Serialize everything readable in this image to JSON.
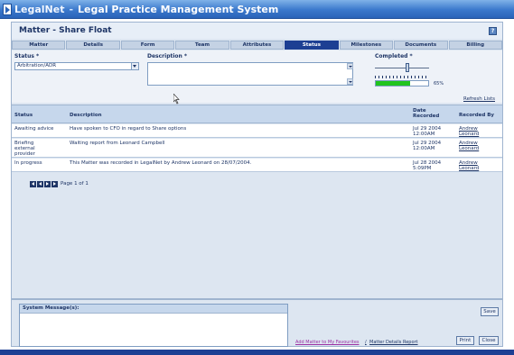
{
  "app": {
    "brand": "LegalNet",
    "separator": "-",
    "title": "Legal Practice Management System"
  },
  "page": {
    "title": "Matter - Share Float",
    "help_icon_label": "?"
  },
  "tabs": [
    {
      "label": "Matter"
    },
    {
      "label": "Details"
    },
    {
      "label": "Form"
    },
    {
      "label": "Team"
    },
    {
      "label": "Attributes"
    },
    {
      "label": "Status",
      "active": true
    },
    {
      "label": "Milestones"
    },
    {
      "label": "Documents"
    },
    {
      "label": "Billing"
    }
  ],
  "form": {
    "status_label": "Status *",
    "status_value": "Arbitration/ADR",
    "description_label": "Description *",
    "description_value": "",
    "completed_label": "Completed *",
    "completed_percent_text": "65%",
    "completed_fraction": 0.65
  },
  "refresh_lists": "Refresh Lists",
  "table": {
    "headers": {
      "status": "Status",
      "description": "Description",
      "date": "Date Recorded",
      "recorded_by": "Recorded By"
    },
    "rows": [
      {
        "status": "Awaiting advice",
        "description": "Have spoken to CFO in regard to Share options",
        "date_line1": "Jul 29 2004",
        "date_line2": "12:00AM",
        "by_line1": "Andrew",
        "by_line2": "Leonard"
      },
      {
        "status": "Briefing external provider",
        "description": "Waiting report from Leonard Campbell",
        "date_line1": "Jul 29 2004",
        "date_line2": "12:00AM",
        "by_line1": "Andrew",
        "by_line2": "Leonard"
      },
      {
        "status": "In progress",
        "description": "This Matter was recorded in LegalNet by Andrew Leonard on 28/07/2004.",
        "date_line1": "Jul 28 2004",
        "date_line2": "5:09PM",
        "by_line1": "Andrew",
        "by_line2": "Leonard"
      }
    ]
  },
  "pager": {
    "text": "Page 1 of 1"
  },
  "system_message": {
    "label": "System Message(s):"
  },
  "buttons": {
    "save": "Save",
    "print": "Print",
    "close": "Close"
  },
  "links": {
    "add_favourites": "Add Matter to My Favourites",
    "slash": "/",
    "details_report": "Matter Details Report"
  },
  "colors": {
    "active_tab": "#1d3f93",
    "progress_fill": "#21c41e",
    "title_bar": "#3a78cc"
  }
}
